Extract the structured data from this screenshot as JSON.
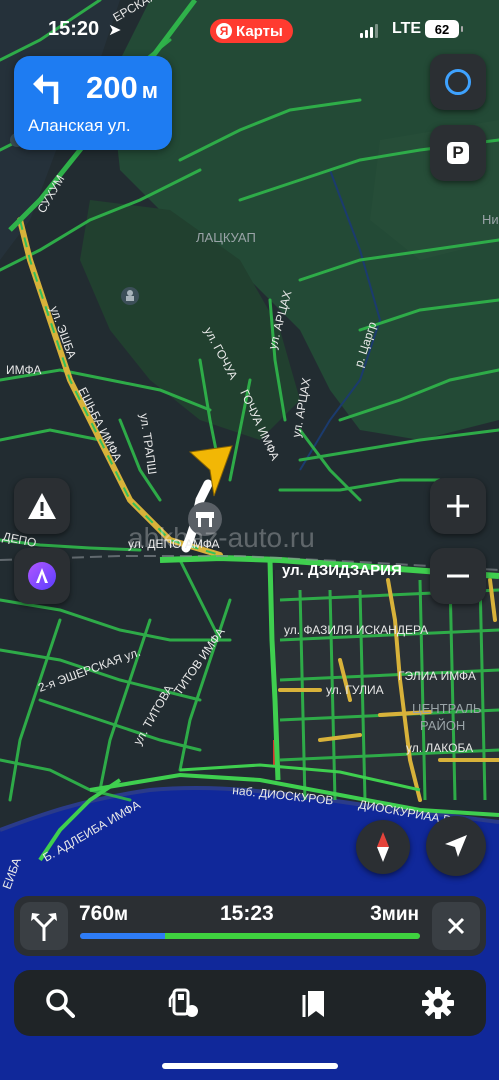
{
  "status_bar": {
    "time": "15:20",
    "brand_mark": "Я",
    "brand_label": "Карты",
    "network": "LTE",
    "battery": "62"
  },
  "maneuver": {
    "distance": "200",
    "unit": "м",
    "street": "Аланская ул."
  },
  "map": {
    "labels": {
      "sukhum": "СУХУМ",
      "eshba": "ул. ЭШБА",
      "eshba_abh": "ЕШЬБА ИМФА",
      "lachkuap": "ЛАЦКУАП",
      "gochua": "ул. ГОЧУА",
      "gochua_abh": "ГОЧУА ИМФА",
      "arcakh": "ул. АРЦАХ",
      "arcakh2": "ул. АРЦАХ",
      "arcakh3": "ул. АРЦАХ",
      "trapsh": "ул. ТРАПШ",
      "tsargr": "р. Царгр",
      "depo": "ул. ДЕПО АМФА",
      "dzidzaria": "ул. ДЗИДЗАРИЯ",
      "fazilya": "ул. ФАЗИЛЯ ИСКАНДЕРА",
      "eshersk": "2-я ЭШЕРСКАЯ ул.",
      "titova": "ул. ТИТОВА",
      "titov_abh": "ТИТОВ ИМФА",
      "gulia": "ул. ГУЛИА",
      "gulia_abh": "ГЭЛИА ИМФА",
      "central": "ЦЕНТРАЛЬ",
      "central2": "РАЙОН",
      "lakoba": "ул. ЛАКОБА",
      "dioskurov": "наб. ДИОСКУРОВ",
      "dioskurov_abh": "ДИОСКУРИАА Р",
      "adleiba": "ЕИБА",
      "adleiba2": "Б. АДЛЕИБА ИМФА",
      "imfa": "ИМФА",
      "depo_left": "ДЕПО",
      "esherskaya_top": "ЕРСКАЯ ул.",
      "ni": "Ни"
    },
    "watermark": "abkhaz-auto.ru"
  },
  "route": {
    "distance": "760",
    "distance_unit": "м",
    "eta": "15:23",
    "duration": "3",
    "duration_unit": "мин",
    "progress_traveled": 0.25,
    "progress_total": 1.0
  },
  "colors": {
    "accent_blue": "#1e7cf2",
    "traffic_green": "#3fd23f",
    "traffic_yellow": "#d8b23a",
    "traffic_red": "#d6342c",
    "sea": "#10289a",
    "panel_bg": "#2b2f33"
  },
  "icons": {
    "maneuver": "turn-left-arrow-icon",
    "alice": "alice-assistant-icon",
    "parking": "parking-icon",
    "report": "warning-icon",
    "zoom_in": "plus-icon",
    "zoom_out": "minus-icon",
    "compass": "compass-icon",
    "locate": "location-arrow-icon",
    "alternatives": "route-fork-icon",
    "close": "close-icon",
    "search": "search-icon",
    "gas": "gas-station-icon",
    "bookmarks": "bookmarks-icon",
    "settings": "settings-gear-icon"
  }
}
